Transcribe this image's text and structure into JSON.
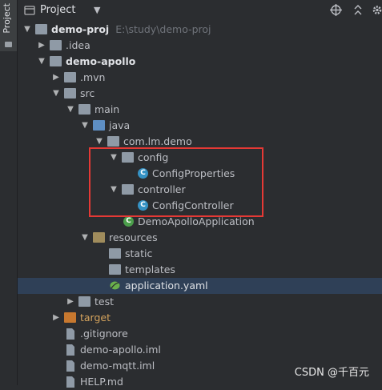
{
  "sidebar": {
    "tab_label": "Project"
  },
  "header": {
    "title": "Project",
    "tools": [
      "crosshair-icon",
      "collapse-icon",
      "settings-icon"
    ]
  },
  "tree": {
    "root_name": "demo-proj",
    "root_path": "E:\\study\\demo-proj",
    "idea": ".idea",
    "module": "demo-apollo",
    "mvn": ".mvn",
    "src": "src",
    "main": "main",
    "java": "java",
    "package": "com.lm.demo",
    "config": "config",
    "config_properties": "ConfigProperties",
    "controller": "controller",
    "config_controller": "ConfigController",
    "app_class": "DemoApolloApplication",
    "resources": "resources",
    "static": "static",
    "templates": "templates",
    "application_yaml": "application.yaml",
    "test": "test",
    "target": "target",
    "gitignore": ".gitignore",
    "demo_apollo_iml": "demo-apollo.iml",
    "demo_mqtt_iml": "demo-mqtt.iml",
    "help_md": "HELP.md"
  },
  "watermark": "CSDN @千百元",
  "colors": {
    "selection": "#2f4057",
    "highlight_box": "#e53935",
    "class_icon": "#3592c4",
    "excluded_folder": "#c7782f"
  }
}
